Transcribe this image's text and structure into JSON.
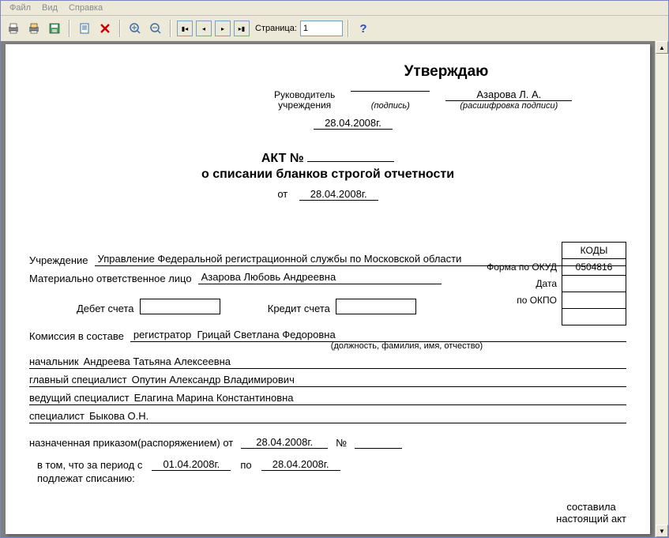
{
  "menu": {
    "file": "Файл",
    "view": "Вид",
    "help": "Справка"
  },
  "toolbar": {
    "page_label": "Страница:",
    "page_value": "1"
  },
  "doc": {
    "approve_title": "Утверждаю",
    "head_label1": "Руководитель",
    "head_label2": "учреждения",
    "sign_cap": "(подпись)",
    "head_name": "Азарова Л. А.",
    "decode_cap": "(расшифровка подписи)",
    "approve_date": "28.04.2008г.",
    "act_no_label": "АКТ №",
    "act_subtitle": "о списании бланков строгой отчетности",
    "from_label": "от",
    "from_date": "28.04.2008г.",
    "codes_head": "КОДЫ",
    "okud_label": "Форма по ОКУД",
    "okud_value": "0504816",
    "date_label": "Дата",
    "okpo_label": "по ОКПО",
    "inst_label": "Учреждение",
    "inst_value": "Управление Федеральной регистрационной службы по Московской области",
    "mol_label": "Материально ответственное лицо",
    "mol_value": "Азарова Любовь Андреевна",
    "debet_label": "Дебет счета",
    "credit_label": "Кредит счета",
    "commission_label": "Комиссия в составе",
    "commission_lead_role": "регистратор",
    "commission_lead_name": "Грицай Светлана Федоровна",
    "commission_cap": "(должность, фамилия, имя, отчество)",
    "members": [
      {
        "role": "начальник",
        "name": "Андреева Татьяна Алексеевна"
      },
      {
        "role": "главный специалист",
        "name": "Опутин Александр Владимирович"
      },
      {
        "role": "ведущий специалист",
        "name": "Елагина Марина Константиновна"
      },
      {
        "role": "специалист",
        "name": "Быкова О.Н."
      }
    ],
    "order_label": "назначенная приказом(распоряжением) от",
    "order_date": "28.04.2008г.",
    "order_no_label": "№",
    "compiled1": "составила",
    "compiled2": "настоящий акт",
    "period_label": "в том, что за период с",
    "period_from": "01.04.2008г.",
    "period_to_label": "по",
    "period_to": "28.04.2008г.",
    "writeoff_label": "подлежат списанию:"
  }
}
